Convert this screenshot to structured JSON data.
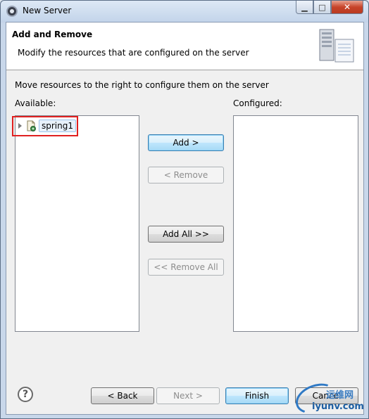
{
  "window": {
    "title": "New Server"
  },
  "banner": {
    "title": "Add and Remove",
    "description": "Modify the resources that are configured on the server"
  },
  "main": {
    "instruction": "Move resources to the right to configure them on the server",
    "available_label": "Available:",
    "configured_label": "Configured:",
    "available_items": [
      {
        "label": "spring1"
      }
    ],
    "configured_items": []
  },
  "buttons": {
    "add": "Add >",
    "remove": "< Remove",
    "add_all": "Add All >>",
    "remove_all": "<< Remove All",
    "back": "< Back",
    "next": "Next >",
    "finish": "Finish",
    "cancel": "Cancel"
  },
  "help": {
    "glyph": "?"
  },
  "watermark": {
    "top": "运维网",
    "bottom": "iyunv.com"
  },
  "colors": {
    "highlight": "#e02020",
    "accent": "#3c7fb1"
  }
}
